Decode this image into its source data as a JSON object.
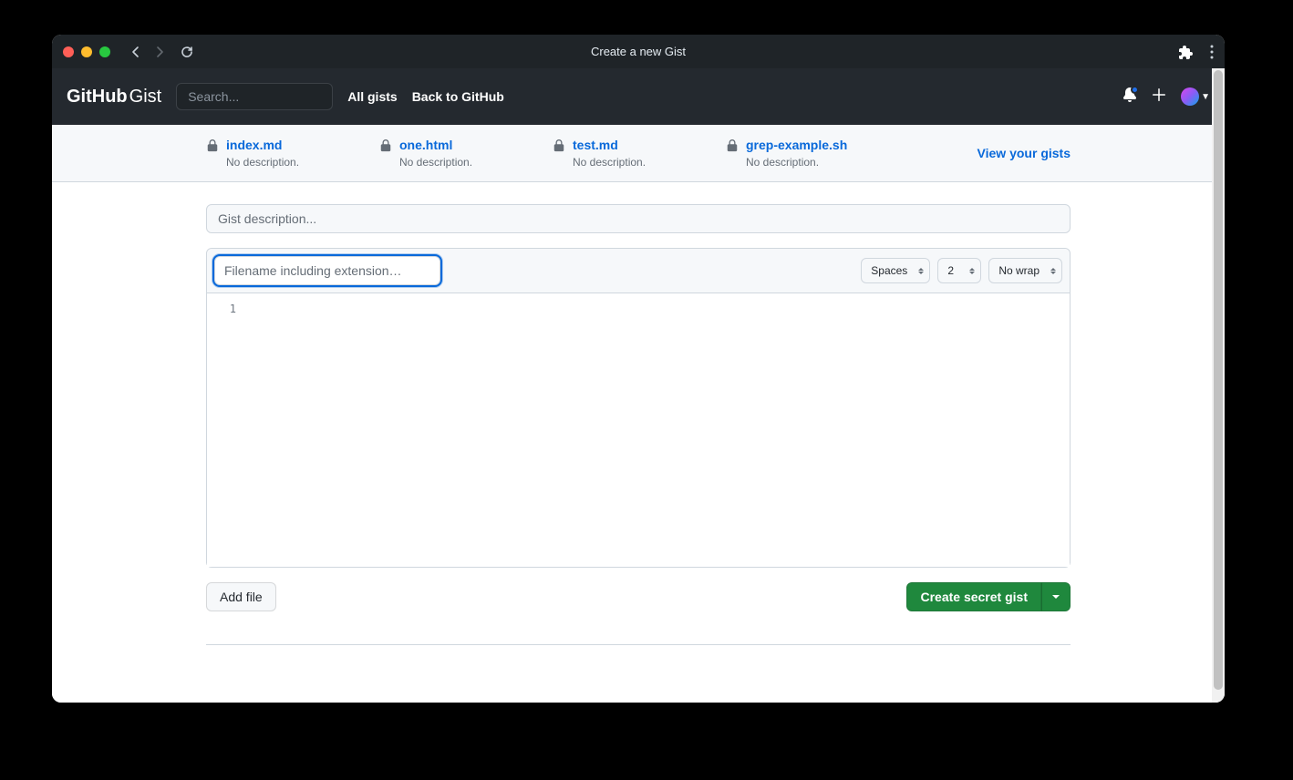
{
  "browser": {
    "title": "Create a new Gist"
  },
  "header": {
    "logo_strong": "GitHub",
    "logo_light": "Gist",
    "search_placeholder": "Search...",
    "links": {
      "all_gists": "All gists",
      "back_to_github": "Back to GitHub"
    }
  },
  "recent": {
    "items": [
      {
        "name": "index.md",
        "desc": "No description."
      },
      {
        "name": "one.html",
        "desc": "No description."
      },
      {
        "name": "test.md",
        "desc": "No description."
      },
      {
        "name": "grep-example.sh",
        "desc": "No description."
      }
    ],
    "view_all": "View your gists"
  },
  "form": {
    "description_placeholder": "Gist description...",
    "filename_placeholder": "Filename including extension…",
    "indent_mode": "Spaces",
    "indent_size": "2",
    "wrap_mode": "No wrap",
    "line_number": "1",
    "add_file": "Add file",
    "create_button": "Create secret gist"
  }
}
